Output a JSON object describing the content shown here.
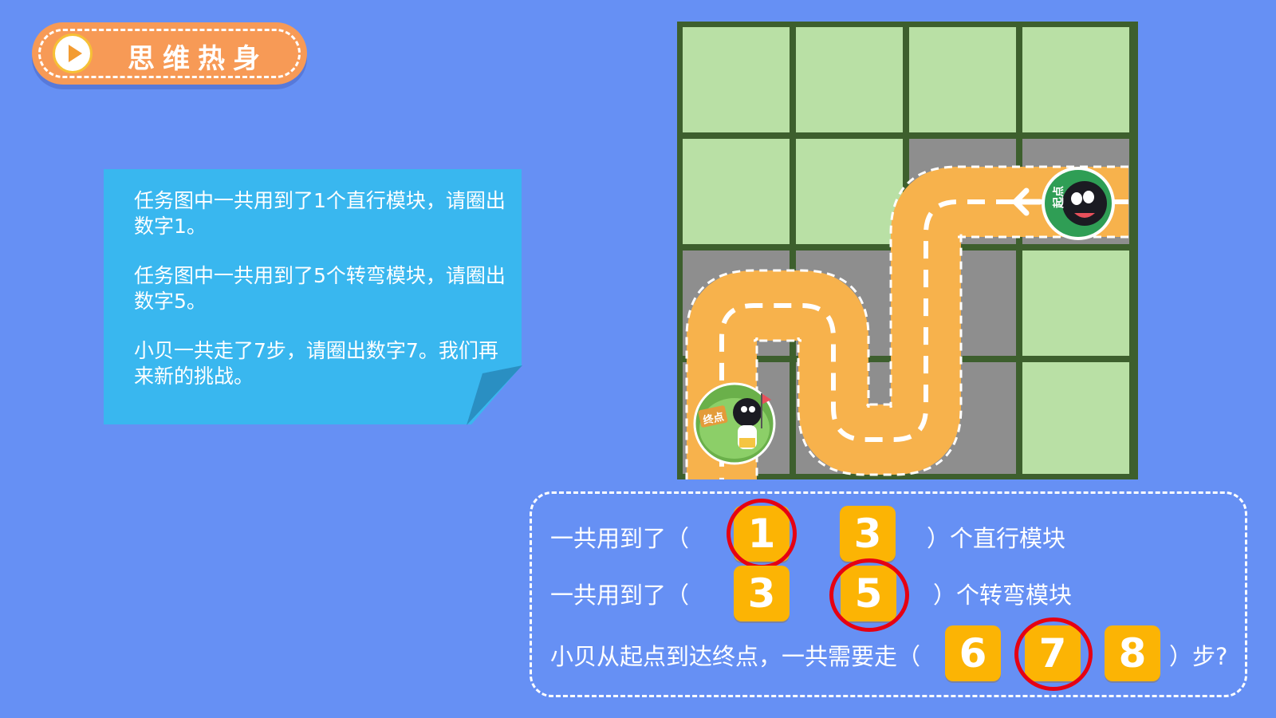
{
  "header": {
    "title": "思维热身"
  },
  "note": {
    "paragraphs": [
      "任务图中一共用到了1个直行模块，请圈出数字1。",
      "任务图中一共用到了5个转弯模块，请圈出数字5。",
      "小贝一共走了7步，请圈出数字7。我们再来新的挑战。"
    ]
  },
  "map": {
    "start_label": "起点",
    "end_label": "终点"
  },
  "questions": [
    {
      "prefix": "一共用到了（",
      "options": [
        "1",
        "3"
      ],
      "suffix": "）个直行模块",
      "circled": "1"
    },
    {
      "prefix": "一共用到了（",
      "options": [
        "3",
        "5"
      ],
      "suffix": "）个转弯模块",
      "circled": "5"
    },
    {
      "prefix": "小贝从起点到达终点，一共需要走（",
      "options": [
        "6",
        "7",
        "8"
      ],
      "suffix": "）步?",
      "circled": "7"
    }
  ],
  "colors": {
    "background": "#6690f4",
    "note": "#39b7ef",
    "grass": "#b9e0a5",
    "road": "#f7b24c",
    "asphalt": "#8e8e8e",
    "grid_line": "#3d5f2d",
    "option_box": "#fcb404",
    "answer_circle": "#e60012"
  }
}
